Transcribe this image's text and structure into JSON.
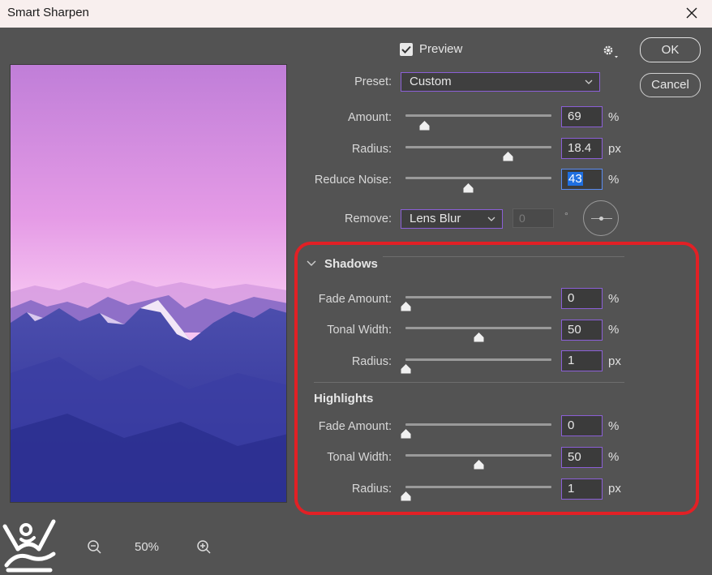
{
  "window": {
    "title": "Smart Sharpen"
  },
  "preview_checkbox": {
    "label": "Preview",
    "checked": true
  },
  "buttons": {
    "ok": "OK",
    "cancel": "Cancel"
  },
  "preset": {
    "label": "Preset:",
    "value": "Custom"
  },
  "main": {
    "amount": {
      "label": "Amount:",
      "value": "69",
      "unit": "%",
      "slider_fraction": 0.13
    },
    "radius": {
      "label": "Radius:",
      "value": "18.4",
      "unit": "px",
      "slider_fraction": 0.7
    },
    "reduce_noise": {
      "label": "Reduce Noise:",
      "value": "43",
      "unit": "%",
      "slider_fraction": 0.43
    }
  },
  "remove": {
    "label": "Remove:",
    "value": "Lens Blur",
    "angle_value": "0",
    "angle_unit": "°"
  },
  "shadows": {
    "title": "Shadows",
    "fade_amount": {
      "label": "Fade Amount:",
      "value": "0",
      "unit": "%",
      "slider_fraction": 0.0
    },
    "tonal_width": {
      "label": "Tonal Width:",
      "value": "50",
      "unit": "%",
      "slider_fraction": 0.5
    },
    "radius": {
      "label": "Radius:",
      "value": "1",
      "unit": "px",
      "slider_fraction": 0.0
    }
  },
  "highlights": {
    "title": "Highlights",
    "fade_amount": {
      "label": "Fade Amount:",
      "value": "0",
      "unit": "%",
      "slider_fraction": 0.0
    },
    "tonal_width": {
      "label": "Tonal Width:",
      "value": "50",
      "unit": "%",
      "slider_fraction": 0.5
    },
    "radius": {
      "label": "Radius:",
      "value": "1",
      "unit": "px",
      "slider_fraction": 0.0
    }
  },
  "zoom": {
    "value": "50%"
  },
  "colors": {
    "accent_border": "#8b5fd6",
    "highlight": "#e22025",
    "panel": "#535353"
  }
}
